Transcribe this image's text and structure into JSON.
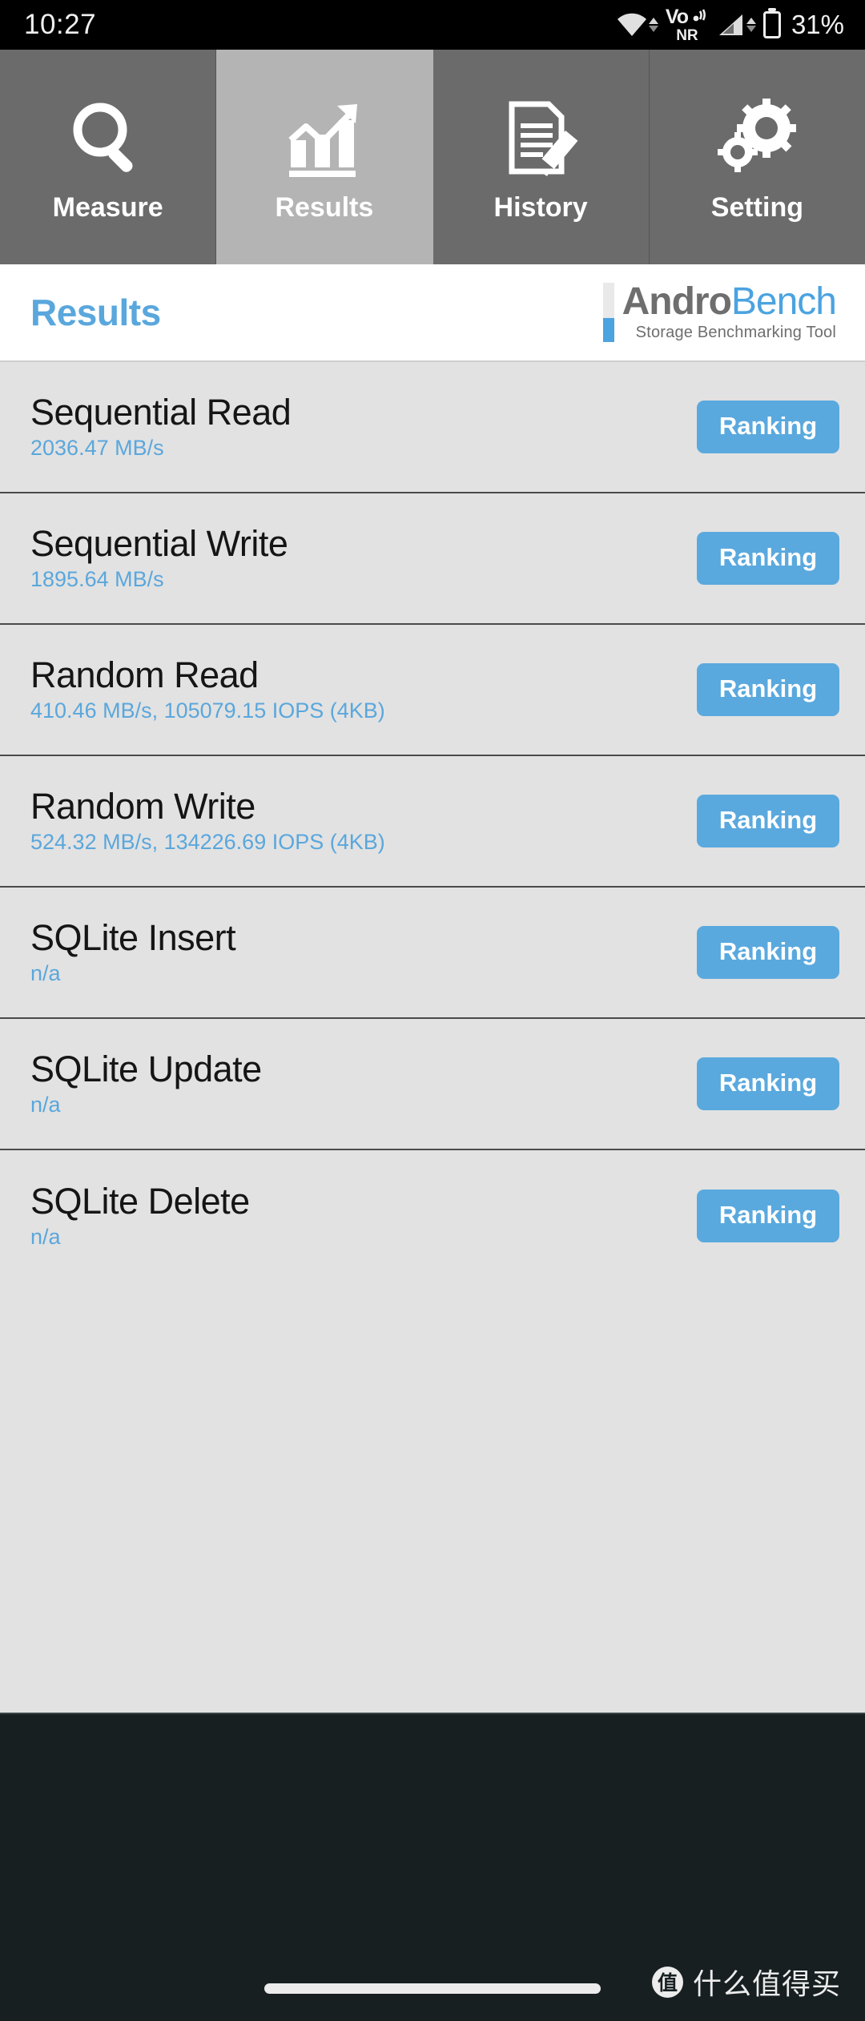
{
  "status_bar": {
    "clock": "10:27",
    "wifi_icon": "wifi-icon",
    "vonr_top": "Vo",
    "vonr_bottom": "NR",
    "signal_icon": "cellular-signal-icon",
    "battery_icon": "battery-icon",
    "battery_percent": "31%"
  },
  "tabs": [
    {
      "label": "Measure",
      "icon": "magnifier-icon",
      "active": false
    },
    {
      "label": "Results",
      "icon": "bar-chart-icon",
      "active": true
    },
    {
      "label": "History",
      "icon": "document-pencil-icon",
      "active": false
    },
    {
      "label": "Setting",
      "icon": "gears-icon",
      "active": false
    }
  ],
  "header": {
    "title": "Results",
    "brand_name_bold": "Andro",
    "brand_name_light": "Bench",
    "brand_tagline": "Storage Benchmarking Tool"
  },
  "results": {
    "ranking_label": "Ranking",
    "rows": [
      {
        "title": "Sequential Read",
        "value": "2036.47 MB/s"
      },
      {
        "title": "Sequential Write",
        "value": "1895.64 MB/s"
      },
      {
        "title": "Random Read",
        "value": "410.46 MB/s, 105079.15 IOPS (4KB)"
      },
      {
        "title": "Random Write",
        "value": "524.32 MB/s, 134226.69 IOPS (4KB)"
      },
      {
        "title": "SQLite Insert",
        "value": "n/a"
      },
      {
        "title": "SQLite Update",
        "value": "n/a"
      },
      {
        "title": "SQLite Delete",
        "value": "n/a"
      }
    ]
  },
  "watermark": {
    "logo_char": "值",
    "text": "什么值得买"
  },
  "colors": {
    "accent_blue": "#5aa9de",
    "title_blue": "#59a7dd",
    "tab_inactive": "#6b6b6b",
    "tab_active": "#b4b4b4",
    "content_bg": "#e2e2e2",
    "dark_bg": "#171f21"
  }
}
